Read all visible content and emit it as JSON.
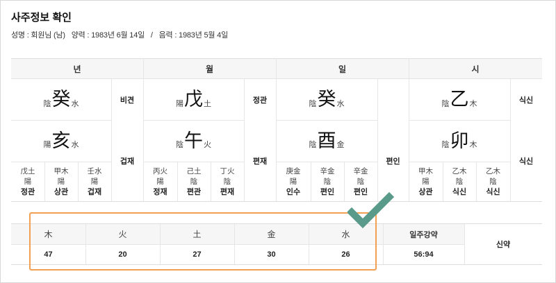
{
  "page": {
    "title": "사주정보 확인",
    "info": {
      "name": "성명 : 회원님 (남)",
      "solar": "양력 : 1983년 6월 14일",
      "sep": "/",
      "lunar": "음력 : 1983년 5월 4일"
    }
  },
  "pillars": [
    {
      "header": "년",
      "stem": {
        "yinyang": "陰",
        "char": "癸",
        "element": "水"
      },
      "stem_god": "비견",
      "branch": {
        "yinyang": "陽",
        "char": "亥",
        "element": "水"
      },
      "branch_god": "겁재",
      "hidden": [
        {
          "gan": "戊土",
          "yy": "陽",
          "god": "정관"
        },
        {
          "gan": "甲木",
          "yy": "陽",
          "god": "상관"
        },
        {
          "gan": "壬水",
          "yy": "陽",
          "god": "겁재"
        }
      ]
    },
    {
      "header": "월",
      "stem": {
        "yinyang": "陽",
        "char": "戊",
        "element": "土"
      },
      "stem_god": "정관",
      "branch": {
        "yinyang": "陰",
        "char": "午",
        "element": "火"
      },
      "branch_god": "편재",
      "hidden": [
        {
          "gan": "丙火",
          "yy": "陽",
          "god": "정재"
        },
        {
          "gan": "己土",
          "yy": "陰",
          "god": "편관"
        },
        {
          "gan": "丁火",
          "yy": "陰",
          "god": "편재"
        }
      ]
    },
    {
      "header": "일",
      "stem": {
        "yinyang": "陰",
        "char": "癸",
        "element": "水"
      },
      "stem_god": "",
      "branch": {
        "yinyang": "陰",
        "char": "酉",
        "element": "金"
      },
      "branch_god": "편인",
      "hidden": [
        {
          "gan": "庚金",
          "yy": "陽",
          "god": "인수"
        },
        {
          "gan": "辛金",
          "yy": "陰",
          "god": "편인"
        },
        {
          "gan": "辛金",
          "yy": "陰",
          "god": "편인"
        }
      ]
    },
    {
      "header": "시",
      "stem": {
        "yinyang": "陰",
        "char": "乙",
        "element": "木"
      },
      "stem_god": "식신",
      "branch": {
        "yinyang": "陰",
        "char": "卯",
        "element": "木"
      },
      "branch_god": "식신",
      "hidden": [
        {
          "gan": "甲木",
          "yy": "陽",
          "god": "상관"
        },
        {
          "gan": "乙木",
          "yy": "陰",
          "god": "식신"
        },
        {
          "gan": "乙木",
          "yy": "陰",
          "god": "식신"
        }
      ]
    }
  ],
  "ohaeng": {
    "elements": [
      {
        "name": "木",
        "value": "47"
      },
      {
        "name": "火",
        "value": "20"
      },
      {
        "name": "土",
        "value": "27"
      },
      {
        "name": "金",
        "value": "30"
      },
      {
        "name": "水",
        "value": "26"
      }
    ],
    "strength_header": "일주강약",
    "strength_ratio": "56:94",
    "strength_result": "신약"
  },
  "colors": {
    "highlight_border": "#f0a050",
    "check_mark": "#5a9a8a"
  },
  "icons": {
    "check": "check-icon"
  }
}
